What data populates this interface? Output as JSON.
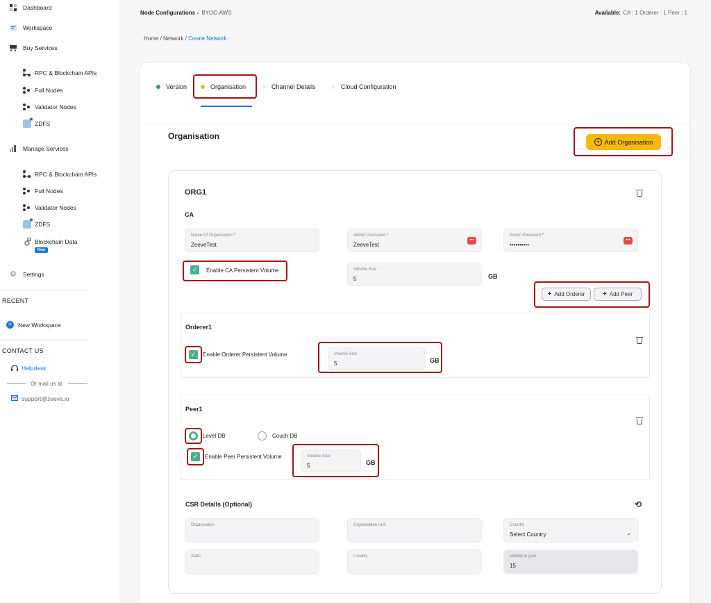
{
  "sidebar": {
    "nav": [
      {
        "label": "Dashboard",
        "icon": "dashboard-icon"
      },
      {
        "label": "Workspace",
        "icon": "workspace-icon"
      },
      {
        "label": "Buy Services",
        "icon": "cart-icon"
      }
    ],
    "buy_services": [
      {
        "label": "RPC & Blockchain APIs",
        "icon": "tree-icon"
      },
      {
        "label": "Full Nodes",
        "icon": "nodes-icon"
      },
      {
        "label": "Validator Nodes",
        "icon": "nodes-icon"
      },
      {
        "label": "ZDFS",
        "icon": "zdfs-icon"
      }
    ],
    "manage_label": "Manage Services",
    "manage_services": [
      {
        "label": "RPC & Blockchain APIs",
        "icon": "tree-icon"
      },
      {
        "label": "Full Nodes",
        "icon": "nodes-icon"
      },
      {
        "label": "Validator Nodes",
        "icon": "nodes-icon"
      },
      {
        "label": "ZDFS",
        "icon": "zdfs-icon"
      },
      {
        "label": "Blockchain Data",
        "icon": "blockchain-data-icon"
      }
    ],
    "new_badge": "New",
    "settings_label": "Settings",
    "recent_title": "RECENT",
    "new_workspace_label": "New Workspace",
    "contact_title": "CONTACT US",
    "helpdesk_label": "Helpdesk",
    "or_mail": "Or mail us at",
    "email": "support@zeeve.io"
  },
  "header": {
    "title": "Node Configurations -",
    "subtitle": "BYOC-AWS",
    "available_label": "Available:",
    "available_value": "CA : 1 Orderer : 1 Peer : 1"
  },
  "breadcrumb": {
    "home": "Home /",
    "network": "Network /",
    "current": "Create Network"
  },
  "tabs": [
    {
      "label": "Version",
      "dot_color": "#1fa463"
    },
    {
      "label": "Organisation",
      "dot_color": "#f6b90c"
    },
    {
      "label": "Channel Details",
      "dot_color": "#eeeeee"
    },
    {
      "label": "Cloud Configuration",
      "dot_color": "#eeeeee"
    }
  ],
  "organisation": {
    "title": "Organisation",
    "add_button": "Add Organisation",
    "org_name": "ORG1",
    "ca_title": "CA",
    "name_label": "Name Of Organisation",
    "name_value": "ZeeveTest",
    "admin_user_label": "Admin Username",
    "admin_user_value": "ZeeveTest",
    "admin_pass_label": "Admin Password",
    "admin_pass_value": "••••••••••",
    "ca_persistent_label": "Enable CA Persistent Volume",
    "volume_label": "Volume Size",
    "ca_volume_value": "5",
    "gb": "GB",
    "add_orderer": "Add Orderer",
    "add_peer": "Add Peer",
    "req_mark": "*"
  },
  "orderer": {
    "title": "Orderer1",
    "persistent_label": "Enable Orderer Persistent Volume",
    "volume_label": "Volume Size",
    "volume_value": "5",
    "gb": "GB"
  },
  "peer": {
    "title": "Peer1",
    "level_db": "Level DB",
    "couch_db": "Couch DB",
    "persistent_label": "Enable Peer Persistent Volume",
    "volume_label": "Volume Size",
    "volume_value": "5",
    "gb": "GB"
  },
  "csr": {
    "title": "CSR Details (Optional)",
    "organisation_label": "Organisation",
    "unit_label": "Organisation Unit",
    "country_label": "Country",
    "country_value": "Select Country",
    "state_label": "State",
    "locality_label": "Locality",
    "validity_label": "Validity in year",
    "validity_value": "15"
  },
  "colors": {
    "accent": "#1a73e8",
    "primary_button": "#f6b90c",
    "check_green": "#4cb08d",
    "highlight": "#a31515"
  }
}
